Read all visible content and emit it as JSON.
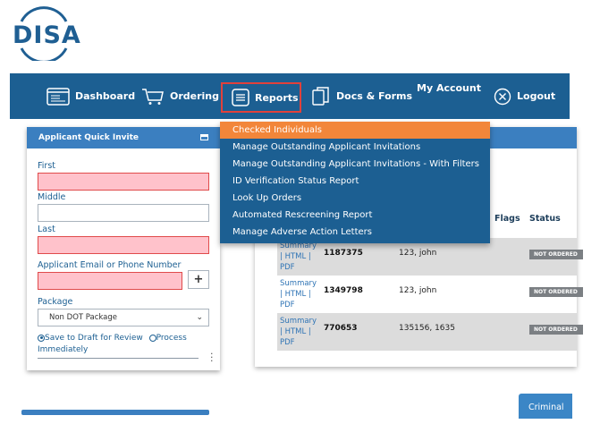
{
  "brand": {
    "logo_text": "DISA",
    "color": "#1f5f93"
  },
  "nav": {
    "dashboard": "Dashboard",
    "ordering": "Ordering",
    "reports": "Reports",
    "docs_forms": "Docs & Forms",
    "my_account": "My Account",
    "logout": "Logout"
  },
  "reports_menu": {
    "items": [
      "Checked Individuals",
      "Manage Outstanding Applicant Invitations",
      "Manage Outstanding Applicant Invitations - With Filters",
      "ID Verification Status Report",
      "Look Up Orders",
      "Automated Rescreening Report",
      "Manage Adverse Action Letters"
    ],
    "active_index": 0
  },
  "quick_invite": {
    "title": "Applicant Quick Invite",
    "first_label": "First",
    "first_value": "",
    "middle_label": "Middle",
    "middle_value": "",
    "last_label": "Last",
    "last_value": "",
    "contact_label": "Applicant Email or Phone Number",
    "contact_value": "",
    "add_label": "+",
    "package_label": "Package",
    "package_selected": "Non DOT Package",
    "option_draft": "Save to Draft for Review",
    "option_process": "Process",
    "option_process_cont": "Immediately"
  },
  "orders_table": {
    "headers": {
      "flags": "Flags",
      "status": "Status"
    },
    "rows": [
      {
        "links": [
          "Summary",
          "| HTML |",
          "PDF"
        ],
        "order": "1187375",
        "name": "123, john",
        "status": "NOT ORDERED"
      },
      {
        "links": [
          "Summary",
          "| HTML |",
          "PDF"
        ],
        "order": "1349798",
        "name": "123, john",
        "status": "NOT ORDERED"
      },
      {
        "links": [
          "Summary",
          "| HTML |",
          "PDF"
        ],
        "order": "770653",
        "name": "135156, 1635",
        "status": "NOT ORDERED"
      }
    ]
  },
  "criminal_tab": "Criminal"
}
